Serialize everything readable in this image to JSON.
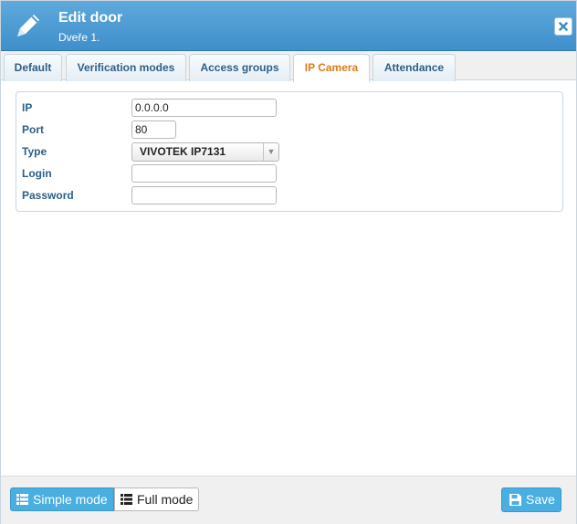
{
  "header": {
    "title": "Edit door",
    "subtitle": "Dveře 1.",
    "icon": "pencil-icon",
    "close_icon": "close-icon"
  },
  "tabs": [
    {
      "label": "Default",
      "active": false
    },
    {
      "label": "Verification modes",
      "active": false
    },
    {
      "label": "Access groups",
      "active": false
    },
    {
      "label": "IP Camera",
      "active": true
    },
    {
      "label": "Attendance",
      "active": false
    }
  ],
  "form": {
    "ip": {
      "label": "IP",
      "value": "0.0.0.0"
    },
    "port": {
      "label": "Port",
      "value": "80"
    },
    "type": {
      "label": "Type",
      "value": "VIVOTEK IP7131"
    },
    "login": {
      "label": "Login",
      "value": ""
    },
    "password": {
      "label": "Password",
      "value": ""
    }
  },
  "footer": {
    "simple_mode_label": "Simple mode",
    "full_mode_label": "Full mode",
    "save_label": "Save",
    "active_mode": "simple"
  },
  "colors": {
    "header": "#4a9bd5",
    "accent_button": "#49aee0",
    "active_tab_text": "#d97c1a",
    "label_text": "#2c5f87"
  }
}
